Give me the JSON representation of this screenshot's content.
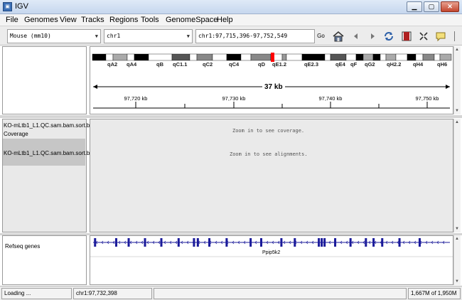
{
  "window": {
    "title": "IGV"
  },
  "menu": [
    "File",
    "Genomes",
    "View",
    "Tracks",
    "Regions",
    "Tools",
    "GenomeSpace",
    "Help"
  ],
  "toolbar": {
    "genome": "Mouse (mm10)",
    "chromosome": "chr1",
    "locus": "chr1:97,715,396-97,752,549",
    "go_label": "Go",
    "icons": [
      "home-icon",
      "back-icon",
      "forward-icon",
      "refresh-icon",
      "region-of-interest-icon",
      "resize-to-window-icon",
      "popup-text-icon"
    ]
  },
  "ideogram": {
    "bands": [
      "qA2",
      "qA4",
      "qB",
      "qC1.1",
      "qC2",
      "qC4",
      "qD",
      "qE1.2",
      "qE2.3",
      "qE4",
      "qF",
      "qG2",
      "qH2.2",
      "qH4",
      "qH6"
    ]
  },
  "ruler": {
    "width_label": "37 kb",
    "ticks": [
      "97,720 kb",
      "97,730 kb",
      "97,740 kb",
      "97,750 kb"
    ]
  },
  "tracks": {
    "coverage_name": "KO-mLtb1_L1.QC.sam.bam.sort.b",
    "coverage_sub": "Coverage",
    "alignment_name": "KO-mLtb1_L1.QC.sam.bam.sort.b",
    "coverage_message": "Zoom in to see coverage.",
    "alignment_message": "Zoom in to see alignments.",
    "feature_track_name": "Refseq genes",
    "gene_name": "Ppip5k2"
  },
  "gene_exons_kb": [
    97715.6,
    97717.8,
    97719.1,
    97720.8,
    97722.5,
    97724.3,
    97725.9,
    97726.3,
    97727.5,
    97729.3,
    97731.8,
    97732.9,
    97735.0,
    97736.4,
    97738.9,
    97739.2,
    97739.5,
    97740.6,
    97742.2,
    97743.8,
    97744.6,
    97745.5,
    97747.3,
    97749.4
  ],
  "colors": {
    "gene": "#1a1a9a",
    "centromere": "#ff0000",
    "statusbar": "#ececec"
  },
  "status": {
    "message": "Loading ...",
    "position": "chr1:97,732,398",
    "memory": "1,667M of 1,950M"
  }
}
